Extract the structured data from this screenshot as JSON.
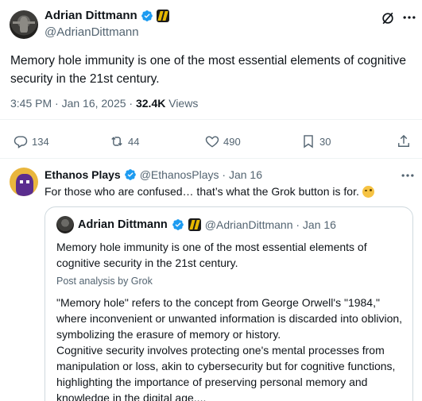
{
  "main_tweet": {
    "display_name": "Adrian Dittmann",
    "handle": "@AdrianDittmann",
    "text": "Memory hole immunity is one of the most essential elements of cognitive security in the 21st century.",
    "time": "3:45 PM · Jan 16, 2025 · ",
    "views_count": "32.4K",
    "views_label": " Views",
    "actions": {
      "replies": "134",
      "reposts": "44",
      "likes": "490",
      "bookmarks": "30"
    }
  },
  "reply": {
    "display_name": "Ethanos Plays",
    "handle_date": "@EthanosPlays · Jan 16",
    "text": "For those who are confused… that’s what the Grok button is for.",
    "quote": {
      "display_name": "Adrian Dittmann",
      "handle_date": "@AdrianDittmann · Jan 16",
      "text": "Memory hole immunity is one of the most essential elements of cognitive security in the 21st century.",
      "analysis_label": "Post analysis by Grok",
      "analysis_p1": "\"Memory hole\" refers to the concept from George Orwell's \"1984,\" where inconvenient or unwanted information is discarded into oblivion, symbolizing the erasure of memory or history.",
      "analysis_p2": "Cognitive security involves protecting one's mental processes from manipulation or loss, akin to cybersecurity but for cognitive functions, highlighting the importance of preserving personal memory and knowledge in the digital age...."
    }
  },
  "colors": {
    "text": "#0f1419",
    "muted": "#536471",
    "verified": "#1d9bf0",
    "border": "#cfd9de"
  }
}
